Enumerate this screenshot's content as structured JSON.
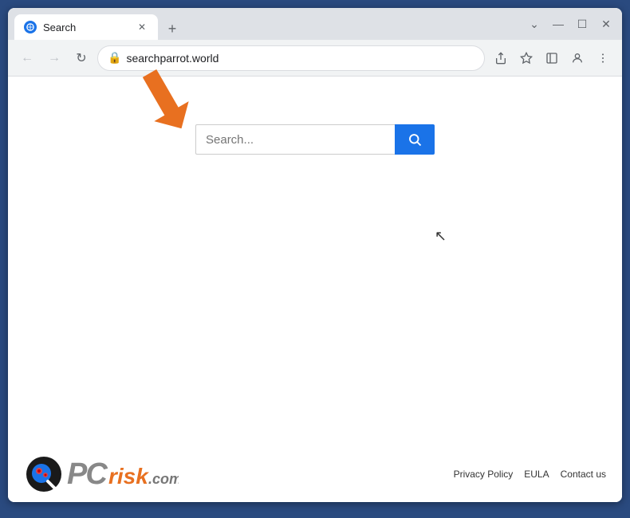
{
  "browser": {
    "tab": {
      "title": "Search",
      "favicon": "globe"
    },
    "new_tab_label": "+",
    "controls": {
      "minimize": "—",
      "maximize": "☐",
      "close": "✕",
      "chevron": "⌄"
    },
    "nav": {
      "back": "←",
      "forward": "→",
      "reload": "↺"
    },
    "address": "searchparrot.world",
    "toolbar_icons": [
      "share",
      "star",
      "sidebar",
      "profile",
      "menu"
    ]
  },
  "page": {
    "search_placeholder": "Search...",
    "search_button_icon": "🔍"
  },
  "footer": {
    "logo_text_pc": "PC",
    "logo_text_risk": "risk",
    "logo_text_com": ".com",
    "links": [
      {
        "label": "Privacy Policy"
      },
      {
        "label": "EULA"
      },
      {
        "label": "Contact us"
      }
    ]
  }
}
